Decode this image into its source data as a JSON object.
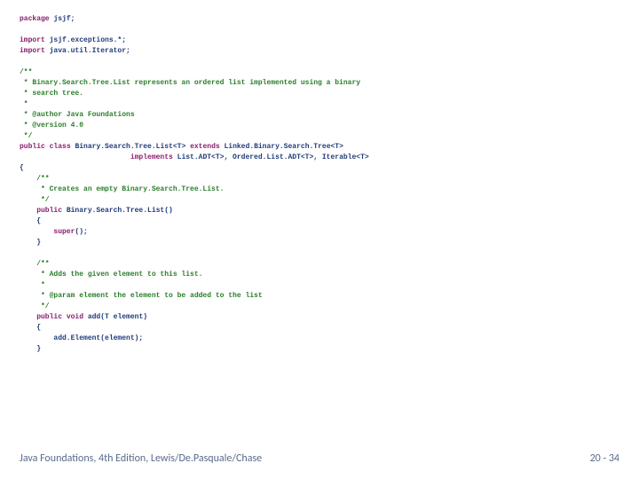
{
  "code": {
    "l1a": "package",
    "l1b": " jsjf;",
    "l3a": "import",
    "l3b": " jsjf.exceptions.*;",
    "l4a": "import",
    "l4b": " java.util.Iterator;",
    "c1": "/**",
    "c2": " * Binary.Search.Tree.List represents an ordered list implemented using a binary",
    "c3": " * search tree.",
    "c4": " *",
    "c5": " * @author Java Foundations",
    "c6": " * @version 4.0",
    "c7": " */",
    "l8a": "public",
    "l8b": " ",
    "l8c": "class",
    "l8d": " Binary.Search.Tree.List<T> ",
    "l8e": "extends",
    "l8f": " Linked.Binary.Search.Tree<T>",
    "l9a": "                          ",
    "l9b": "implements",
    "l9c": " List.ADT<T>, Ordered.List.ADT<T>, Iterable<T>",
    "l10": "{",
    "c8": "    /**",
    "c9": "     * Creates an empty Binary.Search.Tree.List.",
    "c10": "     */",
    "l11a": "    ",
    "l11b": "public",
    "l11c": " Binary.Search.Tree.List()",
    "l12": "    {",
    "l13a": "        ",
    "l13b": "super",
    "l13c": "();",
    "l14": "    }",
    "c11": "    /**",
    "c12": "     * Adds the given element to this list.",
    "c13": "     *",
    "c14": "     * @param element the element to be added to the list",
    "c15": "     */",
    "l15a": "    ",
    "l15b": "public",
    "l15c": " ",
    "l15d": "void",
    "l15e": " add(T element)",
    "l16": "    {",
    "l17": "        add.Element(element);",
    "l18": "    }"
  },
  "footer": {
    "left": "Java Foundations, 4th Edition, Lewis/De.Pasquale/Chase",
    "right": "20 - 34"
  }
}
